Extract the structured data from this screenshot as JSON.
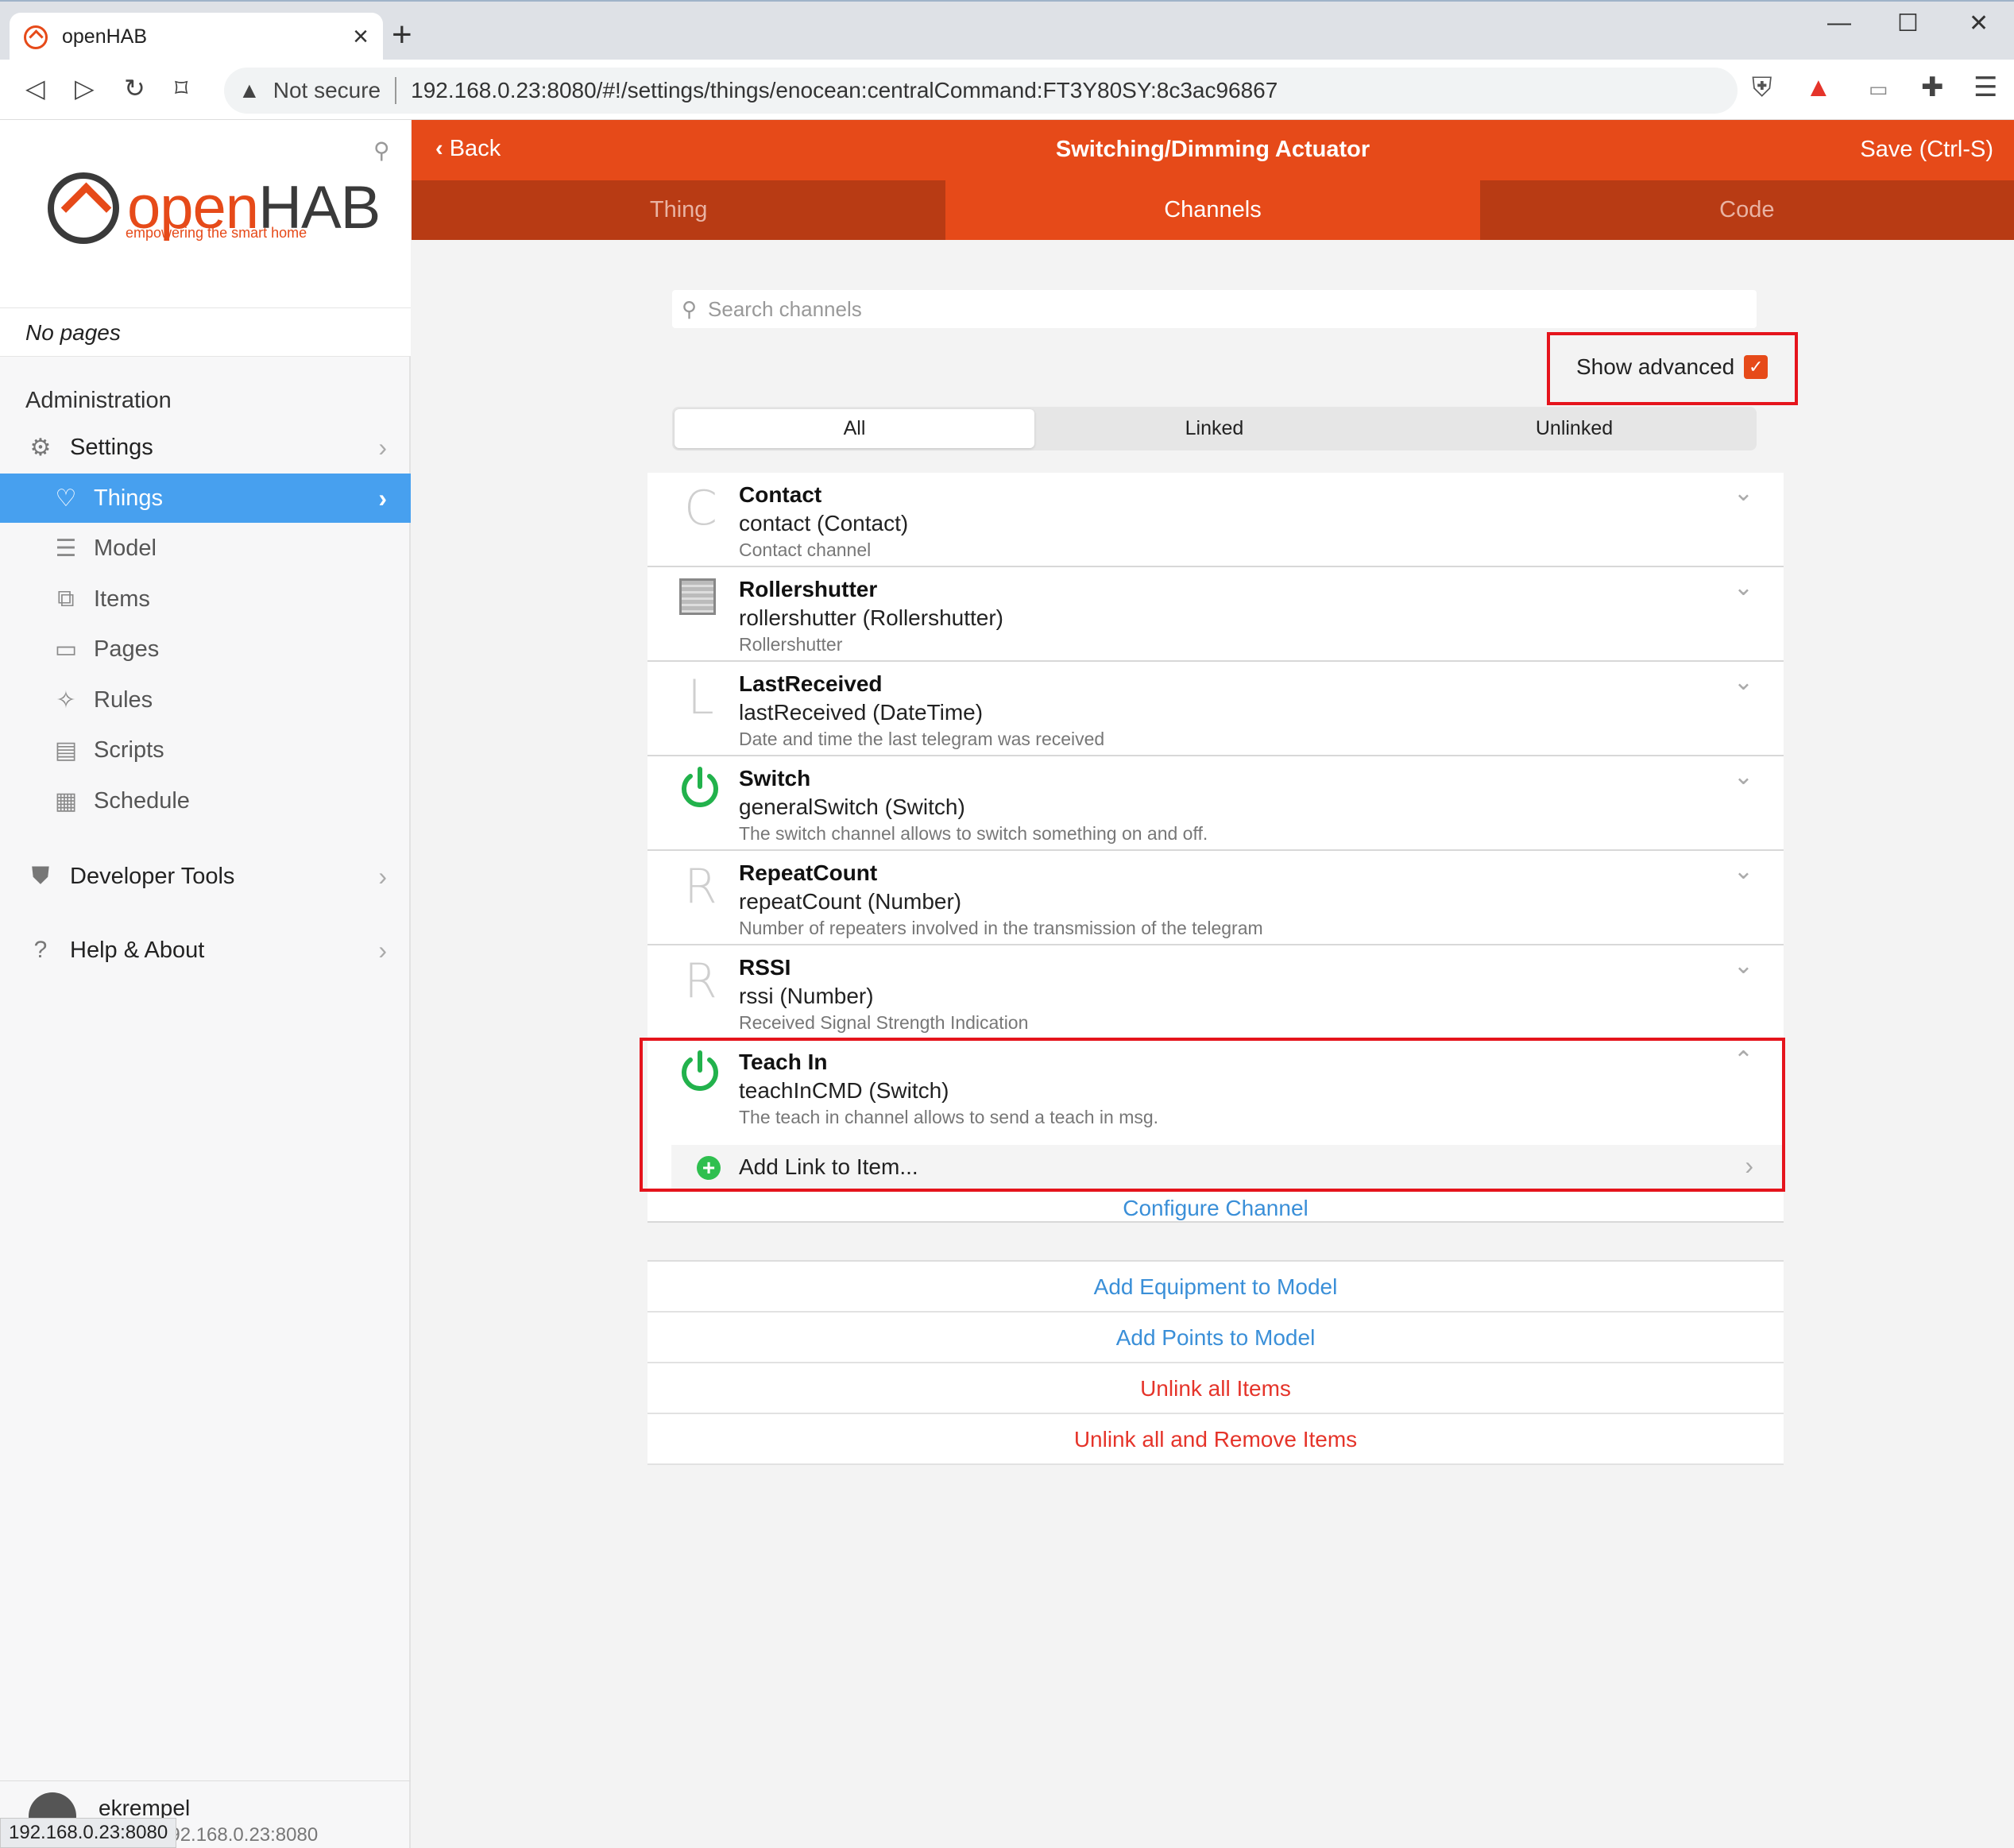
{
  "browser": {
    "tab_title": "openHAB",
    "security_label": "Not secure",
    "url": "192.168.0.23:8080/#!/settings/things/enocean:centralCommand:FT3Y80SY:8c3ac96867",
    "status_url": "192.168.0.23:8080"
  },
  "sidebar": {
    "logo_open": "open",
    "logo_hab": "HAB",
    "logo_tagline": "empowering the smart home",
    "no_pages": "No pages",
    "section": "Administration",
    "items": [
      {
        "label": "Settings",
        "icon": "gear-icon"
      },
      {
        "label": "Things",
        "icon": "lightbulb-icon"
      },
      {
        "label": "Model",
        "icon": "list-icon"
      },
      {
        "label": "Items",
        "icon": "items-icon"
      },
      {
        "label": "Pages",
        "icon": "monitor-icon"
      },
      {
        "label": "Rules",
        "icon": "wand-icon"
      },
      {
        "label": "Scripts",
        "icon": "document-icon"
      },
      {
        "label": "Schedule",
        "icon": "calendar-icon"
      },
      {
        "label": "Developer Tools",
        "icon": "shield-icon"
      },
      {
        "label": "Help & About",
        "icon": "help-icon"
      }
    ],
    "user": {
      "name": "ekrempel",
      "host": "192.168.0.23:8080"
    }
  },
  "header": {
    "back_label": "Back",
    "title": "Switching/Dimming Actuator",
    "save_label": "Save (Ctrl-S)"
  },
  "tabs": [
    "Thing",
    "Channels",
    "Code"
  ],
  "search": {
    "placeholder": "Search channels"
  },
  "show_advanced": {
    "label": "Show advanced",
    "checked": true
  },
  "filter": [
    "All",
    "Linked",
    "Unlinked"
  ],
  "channels": [
    {
      "glyph": "C",
      "name": "Contact",
      "type": "contact (Contact)",
      "desc": "Contact channel"
    },
    {
      "glyph": "",
      "name": "Rollershutter",
      "type": "rollershutter (Rollershutter)",
      "desc": "Rollershutter"
    },
    {
      "glyph": "L",
      "name": "LastReceived",
      "type": "lastReceived (DateTime)",
      "desc": "Date and time the last telegram was received"
    },
    {
      "glyph": "",
      "name": "Switch",
      "type": "generalSwitch (Switch)",
      "desc": "The switch channel allows to switch something on and off."
    },
    {
      "glyph": "R",
      "name": "RepeatCount",
      "type": "repeatCount (Number)",
      "desc": "Number of repeaters involved in the transmission of the telegram"
    },
    {
      "glyph": "R",
      "name": "RSSI",
      "type": "rssi (Number)",
      "desc": "Received Signal Strength Indication"
    },
    {
      "glyph": "",
      "name": "Teach In",
      "type": "teachInCMD (Switch)",
      "desc": "The teach in channel allows to send a teach in msg."
    }
  ],
  "teach_in": {
    "add_link": "Add Link to Item...",
    "configure": "Configure Channel"
  },
  "actions": [
    {
      "label": "Add Equipment to Model",
      "color": "#3a8fd8"
    },
    {
      "label": "Add Points to Model",
      "color": "#3a8fd8"
    },
    {
      "label": "Unlink all Items",
      "color": "#e5342a"
    },
    {
      "label": "Unlink all and Remove Items",
      "color": "#e5342a"
    }
  ],
  "colors": {
    "brand": "#e64a19",
    "active_nav": "#47a0ef",
    "highlight_box": "#e5141c",
    "power_green": "#22b24c"
  }
}
